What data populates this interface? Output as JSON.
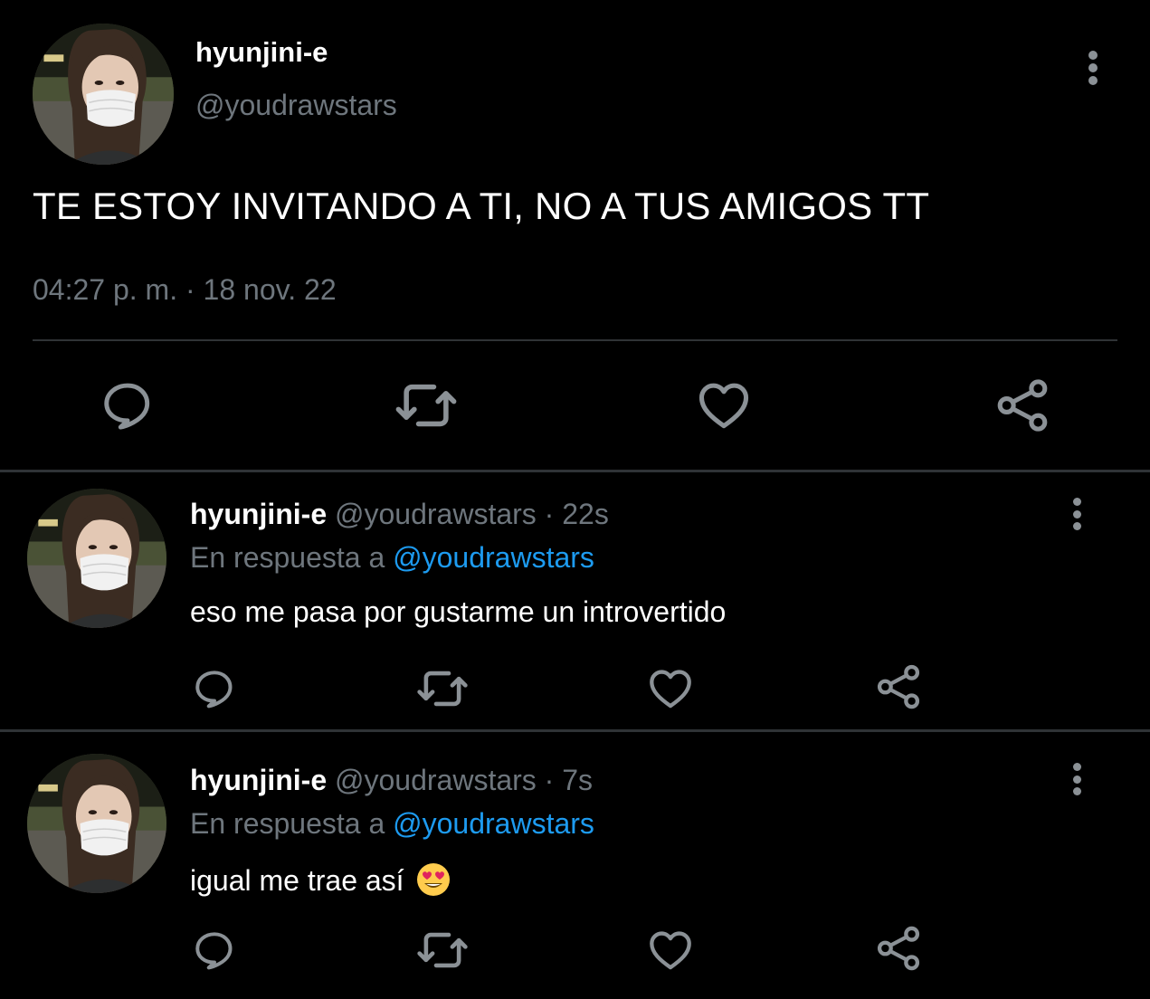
{
  "main_tweet": {
    "display_name": "hyunjini-e",
    "handle": "@youdrawstars",
    "text": "TE ESTOY INVITANDO A TI, NO A TUS AMIGOS TT",
    "timestamp": "04:27 p. m. · 18 nov. 22",
    "actions": [
      "reply-icon",
      "retweet-icon",
      "like-icon",
      "share-icon"
    ]
  },
  "replies": [
    {
      "display_name": "hyunjini-e",
      "handle": "@youdrawstars",
      "separator": "·",
      "time": "22s",
      "reply_prefix": "En respuesta a",
      "reply_mention": "@youdrawstars",
      "text": "eso me pasa por gustarme un introvertido",
      "emoji": ""
    },
    {
      "display_name": "hyunjini-e",
      "handle": "@youdrawstars",
      "separator": "·",
      "time": "7s",
      "reply_prefix": "En respuesta a",
      "reply_mention": "@youdrawstars",
      "text": "igual me trae así",
      "emoji": "heart-eyes-emoji"
    }
  ],
  "colors": {
    "background": "#000000",
    "primary_text": "#ffffff",
    "secondary_text": "#6e767d",
    "link": "#1d9bf0",
    "divider": "#2f3336",
    "icon": "#8b9196"
  }
}
